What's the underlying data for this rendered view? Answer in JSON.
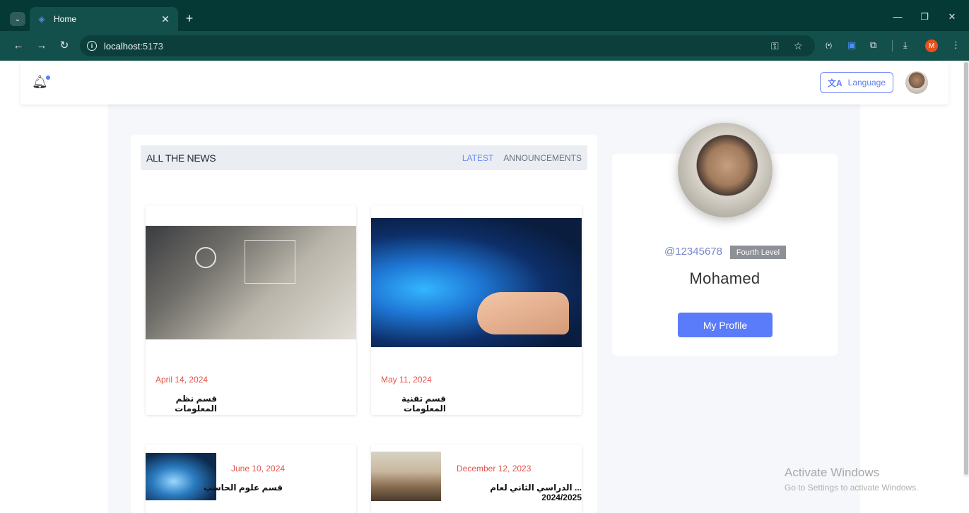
{
  "browser": {
    "tab_title": "Home",
    "url_host": "localhost",
    "url_port": ":5173",
    "profile_initial": "M"
  },
  "header": {
    "language_label": "Language"
  },
  "news": {
    "title": "ALL THE NEWS",
    "tabs": [
      {
        "label": "LATEST",
        "active": true
      },
      {
        "label": "ANNOUNCEMENTS",
        "active": false
      }
    ],
    "articles": [
      {
        "date": "April 14, 2024",
        "title": "قسم نظم المعلومات"
      },
      {
        "date": "May 11, 2024",
        "title": "قسم تقنية المعلومات"
      },
      {
        "date": "June 10, 2024",
        "title": "قسم علوم الحاسب"
      },
      {
        "date": "December 12, 2023",
        "title": "... الدراسي الثاني لعام 2024/2025"
      }
    ]
  },
  "profile": {
    "handle": "@12345678",
    "level": "Fourth Level",
    "name": "Mohamed",
    "button_label": "My Profile"
  },
  "watermark": {
    "line1": "Activate Windows",
    "line2": "Go to Settings to activate Windows."
  },
  "colors": {
    "accent": "#5b7cfa",
    "date_red": "#e5534b",
    "chrome_dark": "#053936",
    "chrome_toolbar": "#14504b"
  }
}
